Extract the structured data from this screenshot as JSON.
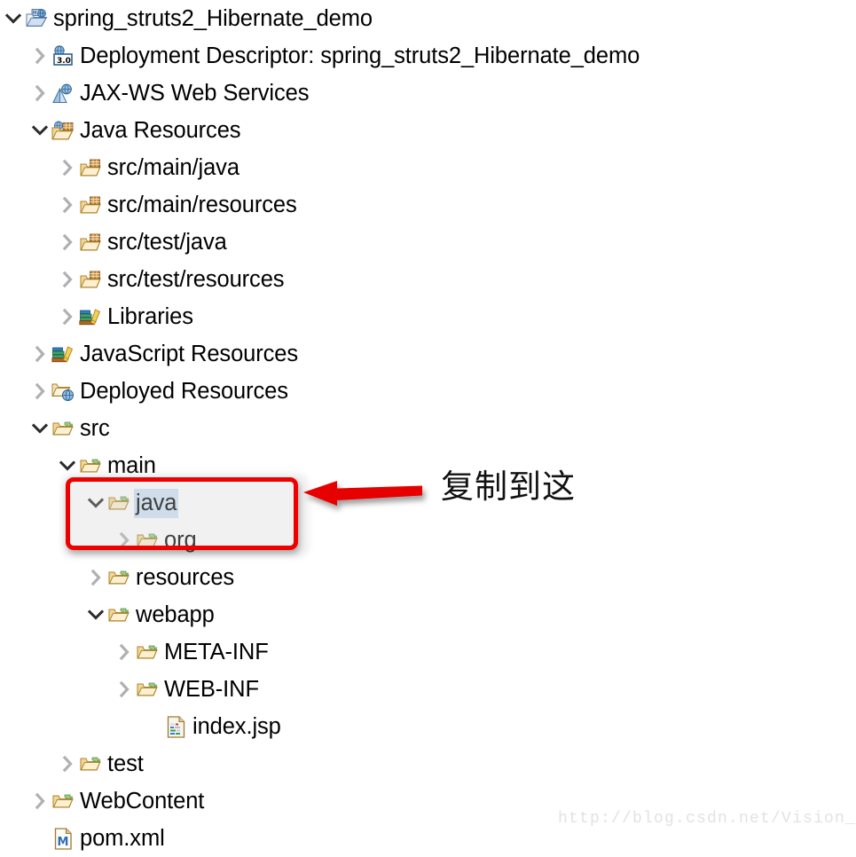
{
  "view": {
    "name": "Project Explorer Tree",
    "colors": {
      "selection_highlight": "#cfe3f7",
      "callout_red": "#ee0000",
      "arrow_red": "#e60000",
      "text": "#000000",
      "twisty_collapsed": "#b4b4b4",
      "twisty_expanded": "#2b2b2b",
      "watermark": "#e2e2e2"
    }
  },
  "tree": {
    "rows": [
      {
        "label": "spring_struts2_Hibernate_demo",
        "indent": 0,
        "twisty": "expanded",
        "icon": "project-web-folder-icon",
        "selected": false
      },
      {
        "label": "Deployment Descriptor: spring_struts2_Hibernate_demo",
        "indent": 1,
        "twisty": "collapsed",
        "icon": "deployment-descriptor-icon",
        "badge": "3.0",
        "selected": false
      },
      {
        "label": "JAX-WS Web Services",
        "indent": 1,
        "twisty": "collapsed",
        "icon": "jaxws-web-services-icon",
        "selected": false
      },
      {
        "label": "Java Resources",
        "indent": 1,
        "twisty": "expanded",
        "icon": "java-resources-icon",
        "selected": false
      },
      {
        "label": "src/main/java",
        "indent": 2,
        "twisty": "collapsed",
        "icon": "source-folder-icon",
        "selected": false
      },
      {
        "label": "src/main/resources",
        "indent": 2,
        "twisty": "collapsed",
        "icon": "source-folder-icon",
        "selected": false
      },
      {
        "label": "src/test/java",
        "indent": 2,
        "twisty": "collapsed",
        "icon": "source-folder-icon",
        "selected": false
      },
      {
        "label": "src/test/resources",
        "indent": 2,
        "twisty": "collapsed",
        "icon": "source-folder-icon",
        "selected": false
      },
      {
        "label": "Libraries",
        "indent": 2,
        "twisty": "collapsed",
        "icon": "libraries-icon",
        "selected": false
      },
      {
        "label": "JavaScript Resources",
        "indent": 1,
        "twisty": "collapsed",
        "icon": "libraries-icon",
        "selected": false
      },
      {
        "label": "Deployed Resources",
        "indent": 1,
        "twisty": "collapsed",
        "icon": "deployed-resources-icon",
        "selected": false
      },
      {
        "label": "src",
        "indent": 1,
        "twisty": "expanded",
        "icon": "folder-icon",
        "selected": false
      },
      {
        "label": "main",
        "indent": 2,
        "twisty": "expanded",
        "icon": "folder-icon",
        "selected": false
      },
      {
        "label": "java",
        "indent": 3,
        "twisty": "expanded",
        "icon": "folder-icon",
        "selected": true
      },
      {
        "label": "org",
        "indent": 4,
        "twisty": "collapsed",
        "icon": "folder-icon",
        "selected": false
      },
      {
        "label": "resources",
        "indent": 3,
        "twisty": "collapsed",
        "icon": "folder-icon",
        "selected": false
      },
      {
        "label": "webapp",
        "indent": 3,
        "twisty": "expanded",
        "icon": "folder-icon",
        "selected": false
      },
      {
        "label": "META-INF",
        "indent": 4,
        "twisty": "collapsed",
        "icon": "folder-icon",
        "selected": false
      },
      {
        "label": "WEB-INF",
        "indent": 4,
        "twisty": "collapsed",
        "icon": "folder-icon",
        "selected": false
      },
      {
        "label": "index.jsp",
        "indent": 5,
        "twisty": "none",
        "icon": "jsp-file-icon",
        "selected": false
      },
      {
        "label": "test",
        "indent": 2,
        "twisty": "collapsed",
        "icon": "folder-icon",
        "selected": false
      },
      {
        "label": "WebContent",
        "indent": 1,
        "twisty": "collapsed",
        "icon": "folder-icon",
        "selected": false
      },
      {
        "label": "pom.xml",
        "indent": 1,
        "twisty": "none",
        "icon": "maven-pom-file-icon",
        "selected": false
      }
    ]
  },
  "annotation": {
    "text": "复制到这",
    "arrow": "left-pointing-red-arrow",
    "highlight_target": "java"
  },
  "watermark": {
    "text": "http://blog.csdn.net/Vision_Tung"
  }
}
